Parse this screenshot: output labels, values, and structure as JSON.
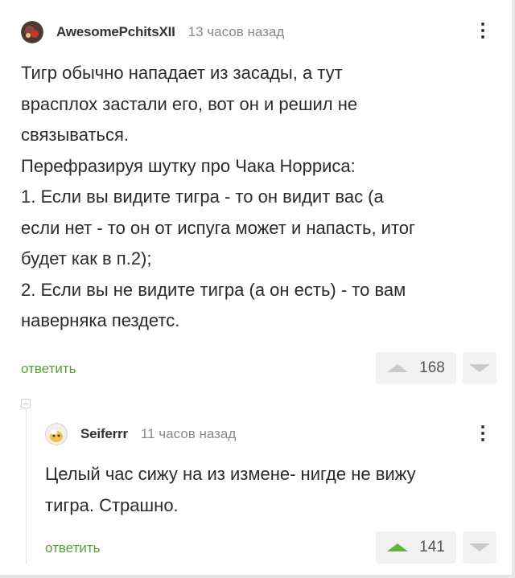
{
  "comments": [
    {
      "username": "AwesomePchitsXII",
      "time": "13 часов назад",
      "lines": [
        "Тигр обычно нападает из засады, а тут",
        "врасплох застали его, вот он и решил не",
        "связываться.",
        "Перефразируя шутку про Чака Норриса:",
        "1. Если вы видите тигра - то он видит вас (а",
        "если нет - то он от испуга может и напасть, итог",
        "будет как в п.2);",
        "2. Если вы не видите тигра (а он есть) - то вам",
        "наверняка пездетс."
      ],
      "reply_label": "ответить",
      "rating": "168",
      "upvoted": false
    },
    {
      "username": "Seiferrr",
      "time": "11 часов назад",
      "lines": [
        "Целый час сижу на из измене- нигде не вижу",
        "тигра. Страшно."
      ],
      "reply_label": "ответить",
      "rating": "141",
      "upvoted": true
    }
  ],
  "icons": {
    "menu": "more-vertical-icon",
    "upvote": "arrow-up-icon",
    "downvote": "arrow-down-icon",
    "collapse": "minus-icon"
  },
  "colors": {
    "accent_green": "#5a9f3a",
    "upvote_active": "#5fb53a",
    "muted_gray": "#8a8a8a"
  }
}
